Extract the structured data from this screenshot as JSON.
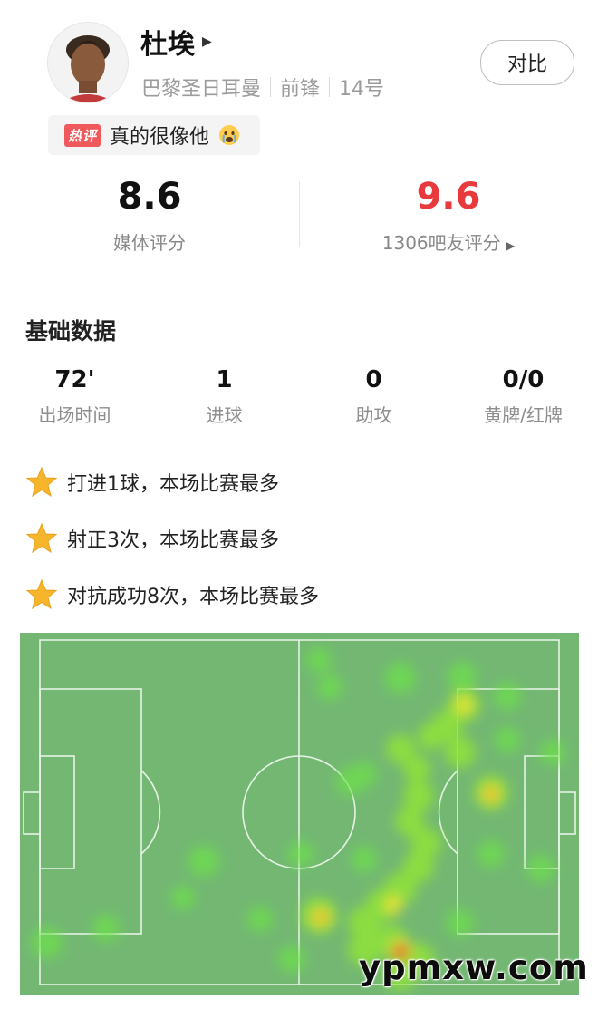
{
  "player": {
    "name": "杜埃",
    "team": "巴黎圣日耳曼",
    "position": "前锋",
    "number": "14号",
    "compare_label": "对比"
  },
  "hot_comment": {
    "tag": "热评",
    "text": "真的很像他",
    "emoji_icon": "crying-face-icon"
  },
  "ratings": {
    "media_value": "8.6",
    "media_label": "媒体评分",
    "fan_value": "9.6",
    "fan_label": "1306吧友评分",
    "fan_color": "#e8393d"
  },
  "basic": {
    "title": "基础数据",
    "stats": [
      {
        "value": "72'",
        "label": "出场时间"
      },
      {
        "value": "1",
        "label": "进球"
      },
      {
        "value": "0",
        "label": "助攻"
      },
      {
        "value": "0/0",
        "label": "黄牌/红牌"
      }
    ]
  },
  "highlights": [
    "打进1球，本场比赛最多",
    "射正3次，本场比赛最多",
    "对抗成功8次，本场比赛最多"
  ],
  "heatmap": {
    "pitch_color": "#73b773",
    "line_color": "#e9f5e9"
  },
  "watermark": "ypmxw.com"
}
